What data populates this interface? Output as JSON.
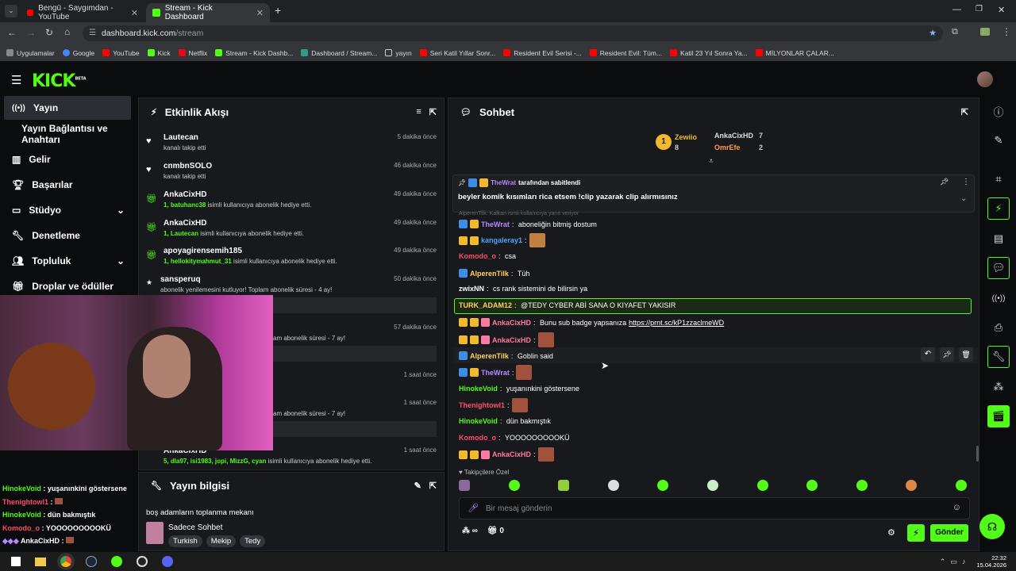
{
  "browser": {
    "tabs": [
      {
        "title": "Bengü - Saygımdan - YouTube"
      },
      {
        "title": "Stream - Kick Dashboard"
      }
    ],
    "url_host": "dashboard.kick.com",
    "url_path": "/stream",
    "bookmarks": [
      "Uygulamalar",
      "Google",
      "YouTube",
      "Kick",
      "Netflix",
      "Stream - Kick Dashb...",
      "Dashboard / Stream...",
      "yayın",
      "Seri Katil Yıllar Sonr...",
      "Resident Evil Serisi -...",
      "Resident Evil: Tüm...",
      "Katil 23 Yıl Sonra Ya...",
      "MİLYONLAR ÇALAR..."
    ]
  },
  "app": {
    "logo": "KICK",
    "beta": "BETA"
  },
  "sidebar": {
    "items": [
      {
        "label": "Yayın",
        "icon": "broadcast-icon"
      },
      {
        "label": "Yayın Bağlantısı ve Anahtarı",
        "icon": ""
      },
      {
        "label": "Gelir",
        "icon": "chart-icon"
      },
      {
        "label": "Başarılar",
        "icon": "trophy-icon"
      },
      {
        "label": "Stüdyo",
        "icon": "monitor-icon"
      },
      {
        "label": "Denetleme",
        "icon": "wrench-icon"
      },
      {
        "label": "Topluluk",
        "icon": "users-icon"
      },
      {
        "label": "Droplar ve ödüller",
        "icon": "gift-icon"
      }
    ]
  },
  "activity": {
    "title": "Etkinlik Akışı",
    "events": [
      {
        "name": "Lautecan",
        "desc": "kanalı takip etti",
        "time": "5 dakika önce",
        "highlight": ""
      },
      {
        "name": "cnmbnSOLO",
        "desc": "kanalı takip etti",
        "time": "46 dakika önce",
        "highlight": ""
      },
      {
        "name": "AnkaCixHD",
        "highlight": "1, batuhanc38",
        "desc": " isimli kullanıcıya abonelik hediye etti.",
        "time": "49 dakika önce"
      },
      {
        "name": "AnkaCixHD",
        "highlight": "1, Lautecan",
        "desc": " isimli kullanıcıya abonelik hediye etti.",
        "time": "49 dakika önce"
      },
      {
        "name": "apoyagirensemih185",
        "highlight": "1, hellokitymahmut_31",
        "desc": " isimli kullanıcıya abonelik hediye etti.",
        "time": "49 dakika önce"
      },
      {
        "name": "sansperuq",
        "highlight": "",
        "desc": "abonelik yenilemesini kutluyor! Toplam abonelik süresi - 4 ay!",
        "time": "50 dakika önce"
      }
    ],
    "partial": [
      {
        "desc": "am abonelik süresi - 7 ay!",
        "time": "57 dakika önce"
      },
      {
        "desc": "",
        "time": "1 saat önce"
      },
      {
        "desc": "am abonelik süresi - 7 ay!",
        "time": "1 saat önce"
      }
    ],
    "last": {
      "name": "AnkaCixHD",
      "highlight": "5, dla97, isi1983, jopi, MizzG, cyan",
      "desc": " isimli kullanıcıya abonelik hediye etti.",
      "time": "1 saat önce"
    }
  },
  "stream_info": {
    "title": "Yayın bilgisi",
    "stream_title": "boş adamların toplanma mekanı",
    "category": "Sadece Sohbet",
    "tags": [
      "Turkish",
      "Mekip",
      "Tedy"
    ]
  },
  "overlay_chat": [
    {
      "user": "HinokeVoid",
      "text": " : yuşanınkini göstersene",
      "color": "#53fc18"
    },
    {
      "user": "Thenightowl1",
      "text": " : ",
      "color": "#ff4c6a"
    },
    {
      "user": "HinokeVoid",
      "text": " : dün bakmıştık",
      "color": "#53fc18"
    },
    {
      "user": "Komodo_o",
      "text": " : YOOOOOOOOOKÜ",
      "color": "#ff4c6a"
    },
    {
      "user": "AnkaCixHD",
      "text": " : ",
      "color": "#fff"
    }
  ],
  "chat": {
    "title": "Sohbet",
    "leaderboard": {
      "first": {
        "name": "Zewiio",
        "count": "8"
      },
      "second": {
        "name": "AnkaCixHD",
        "count": "7"
      },
      "third": {
        "name": "OmrEfe",
        "count": "2"
      },
      "rank": "1"
    },
    "pinned": {
      "user": "TheWrat",
      "pinned_by": " tarafından sabitlendi",
      "text": "beyler komik kısımları rica etsem !clip yazarak clip alırmısınız"
    },
    "reply_hint": "AlperenTilk: Kalkan ismli kullanıcıya yanıt veriyor",
    "messages": [
      {
        "user": "TheWrat",
        "color": "#b886ff",
        "text": "aboneliğin bitmiş dostum"
      },
      {
        "user": "kangaleray1",
        "color": "#4aa3ff",
        "text": ""
      },
      {
        "user": "Komodo_o",
        "color": "#ff4c6a",
        "text": "csa"
      },
      {
        "user": "AlperenTilk",
        "color": "#ffd45c",
        "text": "Tüh"
      },
      {
        "user": "zwixNN",
        "color": "#ffffff",
        "text": "cs rank sistemini de bilirsin ya"
      },
      {
        "user": "TURK_ADAM12",
        "color": "#ffd45c",
        "text": "@TEDY CYBER ABİ SANA O KIYAFET YAKISIR"
      },
      {
        "user": "AnkaCixHD",
        "color": "#ff7aa2",
        "text": "Bunu sub badge yapsanıza ",
        "link": "https://prnt.sc/kP1zzaclmeWD"
      },
      {
        "user": "AnkaCixHD",
        "color": "#ff7aa2",
        "text": ""
      },
      {
        "user": "AlperenTilk",
        "color": "#ffd45c",
        "text": "Goblin said"
      },
      {
        "user": "TheWrat",
        "color": "#b886ff",
        "text": ""
      },
      {
        "user": "HinokeVoid",
        "color": "#53fc18",
        "text": "yuşanınkini göstersene"
      },
      {
        "user": "Thenightowl1",
        "color": "#ff4c6a",
        "text": ""
      },
      {
        "user": "HinokeVoid",
        "color": "#53fc18",
        "text": "dün bakmıştık"
      },
      {
        "user": "Komodo_o",
        "color": "#ff4c6a",
        "text": "YOOOOOOOOOKÜ"
      },
      {
        "user": "AnkaCixHD",
        "color": "#ff7aa2",
        "text": ""
      }
    ],
    "followers_only": "Takipçilere Özel",
    "input_placeholder": "Bir mesaj gönderin",
    "infinity": "∞",
    "counter": "0",
    "send": "Gönder"
  },
  "taskbar": {
    "time": "22:32",
    "date": "15.04.2026"
  },
  "colors": {
    "accent": "#53fc18"
  }
}
